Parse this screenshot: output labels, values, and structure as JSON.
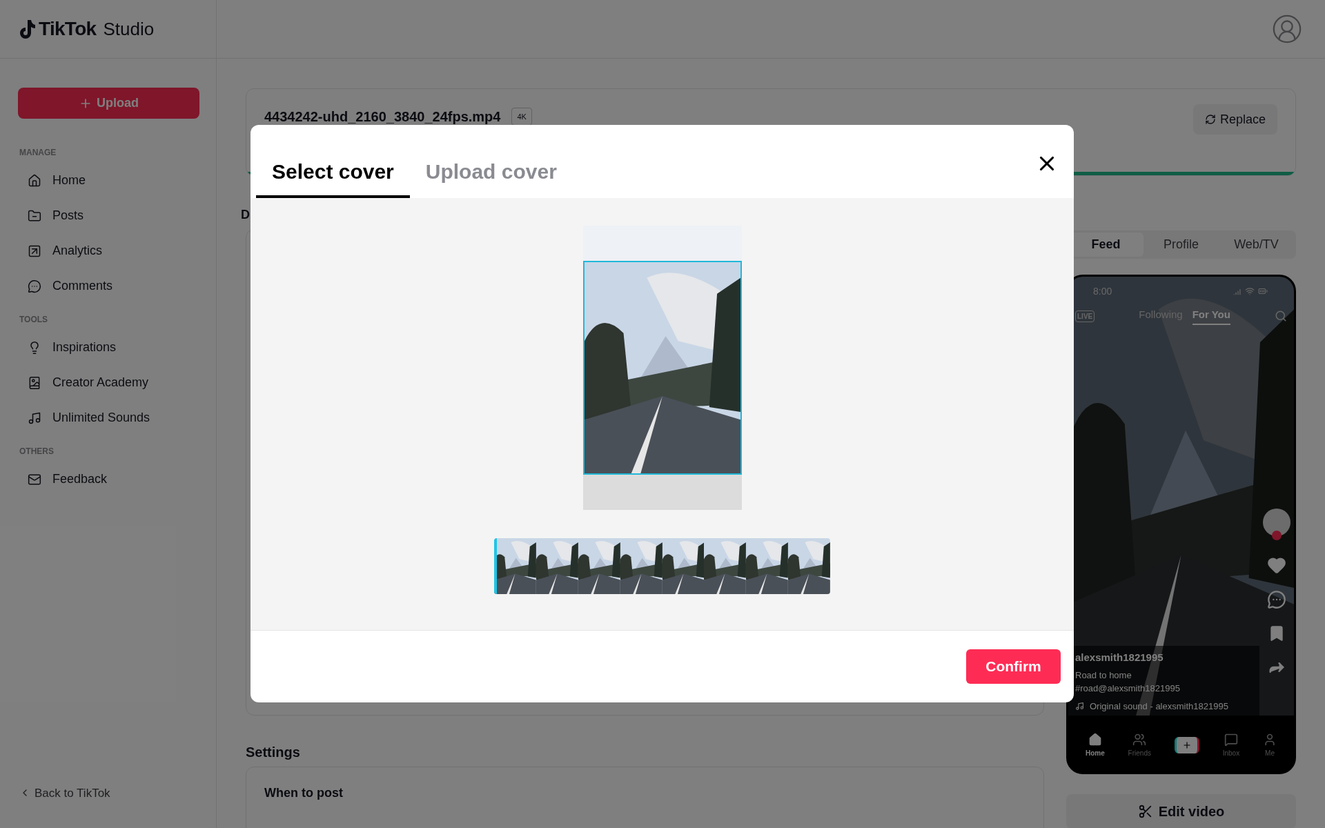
{
  "brand": {
    "name": "TikTok",
    "suffix": "Studio"
  },
  "sidebar": {
    "upload_button": "Upload",
    "sections": [
      {
        "title": "MANAGE",
        "items": [
          {
            "label": "Home"
          },
          {
            "label": "Posts"
          },
          {
            "label": "Analytics"
          },
          {
            "label": "Comments"
          }
        ]
      },
      {
        "title": "TOOLS",
        "items": [
          {
            "label": "Inspirations"
          },
          {
            "label": "Creator Academy"
          },
          {
            "label": "Unlimited Sounds"
          }
        ]
      },
      {
        "title": "OTHERS",
        "items": [
          {
            "label": "Feedback"
          }
        ]
      }
    ],
    "back_link": "Back to TikTok"
  },
  "file": {
    "name": "4434242-uhd_2160_3840_24fps.mp4",
    "badge": "4K",
    "replace_button": "Replace",
    "upload_progress": {
      "level": 1
    }
  },
  "details_heading": "D",
  "settings": {
    "heading": "Settings",
    "when_to_post": "When to post"
  },
  "preview_tabs": [
    {
      "label": "Feed",
      "selected": true
    },
    {
      "label": "Profile",
      "selected": false
    },
    {
      "label": "Web/TV",
      "selected": false
    }
  ],
  "phone": {
    "time": "8:00",
    "live": "LIVE",
    "feed_tabs": [
      {
        "label": "Following",
        "selected": false
      },
      {
        "label": "For You",
        "selected": true
      }
    ],
    "username": "alexsmith1821995",
    "caption": "Road to home",
    "hashtags": "#road@alexsmith1821995",
    "sound": "Original sound - alexsmith1821995",
    "nav": [
      {
        "label": "Home",
        "selected": true
      },
      {
        "label": "Friends",
        "selected": false
      },
      {
        "label": "Inbox",
        "selected": false
      },
      {
        "label": "Me",
        "selected": false
      }
    ]
  },
  "edit_video_button": "Edit video",
  "modal": {
    "tabs": [
      {
        "label": "Select cover",
        "selected": true
      },
      {
        "label": "Upload cover",
        "selected": false
      }
    ],
    "filmstrip": {
      "level": 0
    },
    "confirm_button": "Confirm"
  }
}
